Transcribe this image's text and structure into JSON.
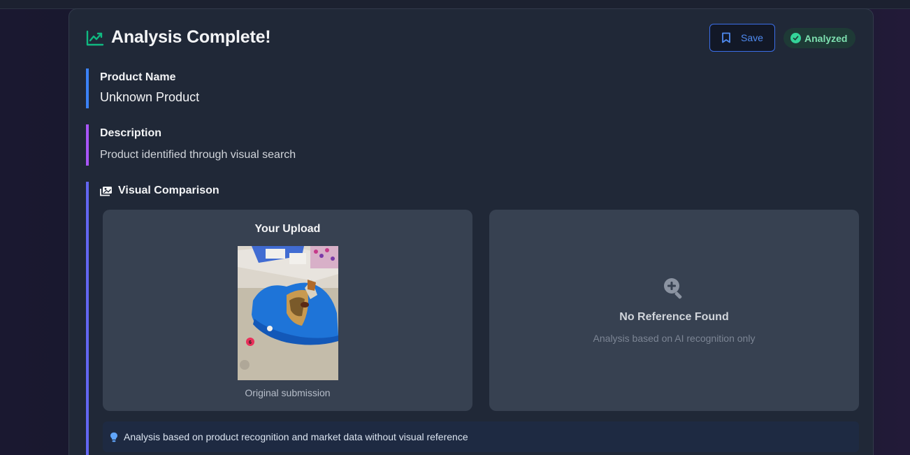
{
  "header": {
    "title": "Analysis Complete!",
    "save_label": "Save",
    "status_badge": "Analyzed"
  },
  "product_name": {
    "label": "Product Name",
    "value": "Unknown Product"
  },
  "description": {
    "label": "Description",
    "value": "Product identified through visual search"
  },
  "visual_comparison": {
    "heading": "Visual Comparison",
    "upload": {
      "title": "Your Upload",
      "caption": "Original submission"
    },
    "reference": {
      "title": "No Reference Found",
      "subtitle": "Analysis based on AI recognition only"
    },
    "note": "Analysis based on product recognition and market data without visual reference"
  },
  "colors": {
    "accent_green": "#10b981",
    "save_blue": "#3b82f6",
    "name_bar": "#3b82f6",
    "desc_bar": "#a855f7",
    "visual_bar": "#6366f1",
    "badge_text": "#7ee0b0"
  },
  "icons": {
    "header": "trending-up-icon",
    "save": "bookmark-icon",
    "badge": "check-circle-icon",
    "visual": "images-icon",
    "reference": "zoom-in-icon",
    "note": "lightbulb-icon"
  }
}
